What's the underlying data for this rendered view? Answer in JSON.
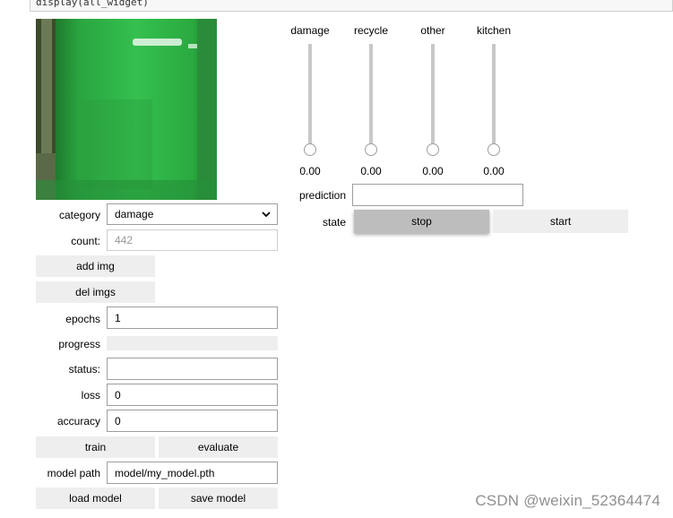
{
  "code_cell": {
    "text": "display(all_widget)"
  },
  "camera": {
    "description": "camera frame"
  },
  "category": {
    "label": "category",
    "value": "damage"
  },
  "count": {
    "label": "count:",
    "value": "442"
  },
  "add_img": {
    "label": "add img"
  },
  "del_imgs": {
    "label": "del imgs"
  },
  "epochs": {
    "label": "epochs",
    "value": "1"
  },
  "progress": {
    "label": "progress",
    "value": 0
  },
  "status": {
    "label": "status:",
    "value": ""
  },
  "loss": {
    "label": "loss",
    "value": "0"
  },
  "accuracy": {
    "label": "accuracy",
    "value": "0"
  },
  "train": {
    "label": "train"
  },
  "evaluate": {
    "label": "evaluate"
  },
  "model_path": {
    "label": "model path",
    "value": "model/my_model.pth"
  },
  "load_model": {
    "label": "load model"
  },
  "save_model": {
    "label": "save model"
  },
  "sliders": [
    {
      "name": "damage",
      "value": "0.00",
      "level": 0
    },
    {
      "name": "recycle",
      "value": "0.00",
      "level": 0
    },
    {
      "name": "other",
      "value": "0.00",
      "level": 0
    },
    {
      "name": "kitchen",
      "value": "0.00",
      "level": 0
    }
  ],
  "prediction": {
    "label": "prediction",
    "value": ""
  },
  "state": {
    "label": "state",
    "stop": "stop",
    "start": "start"
  },
  "watermark": {
    "text": "CSDN @weixin_52364474"
  },
  "colors": {
    "button": "#eeeeee",
    "pressed": "#bdbdbd",
    "camera_green": "#2fb04a"
  }
}
